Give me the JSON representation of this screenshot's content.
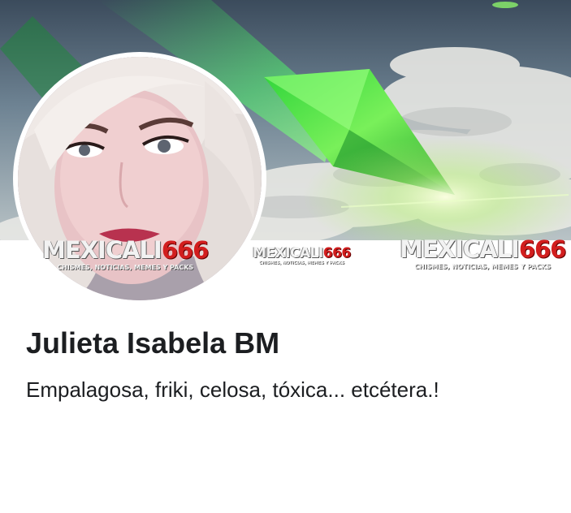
{
  "profile": {
    "name": "Julieta Isabela BM",
    "bio": "Empalagosa, friki, celosa, tóxica... etcétera.!"
  },
  "watermarks": [
    {
      "word": "MEXICALI",
      "number": "666",
      "tagline": "CHISMES, NOTICIAS, MEMES Y PACKS"
    },
    {
      "word": "MEXICALI",
      "number": "666",
      "tagline": "CHISMES, NOTICIAS, MEMES Y PACKS"
    },
    {
      "word": "MEXICALI",
      "number": "666",
      "tagline": "CHISMES, NOTICIAS, MEMES Y PACKS"
    }
  ],
  "colors": {
    "text": "#1c1e21",
    "watermark_accent": "#d21e1e",
    "cover_green": "#3fdc3a"
  }
}
